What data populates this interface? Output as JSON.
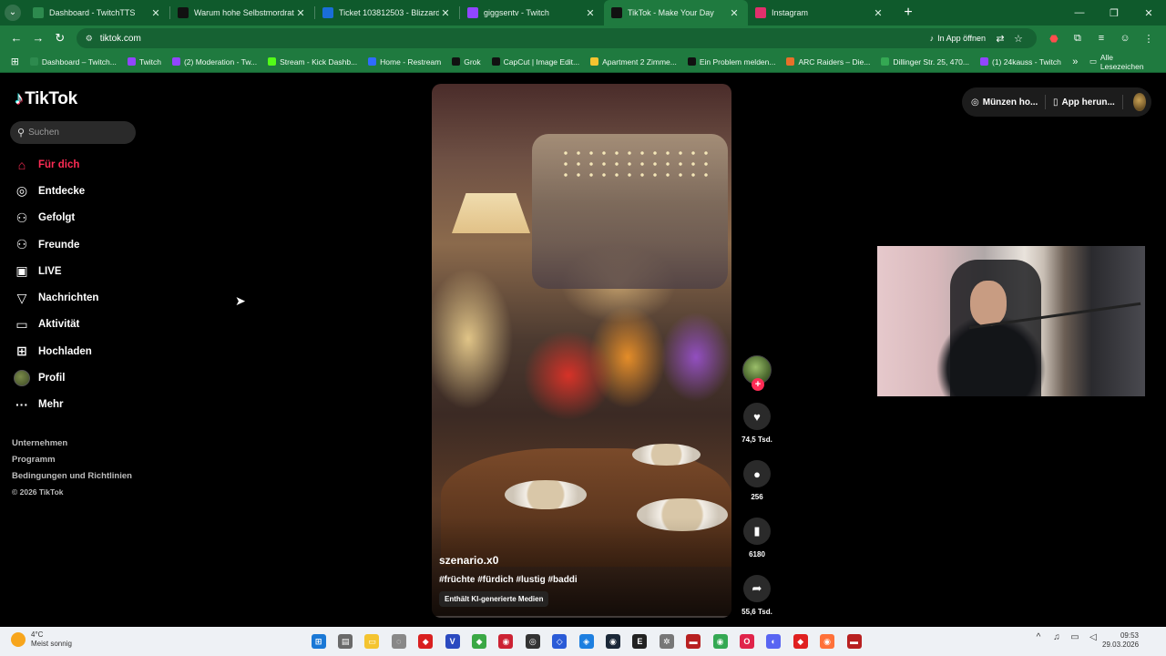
{
  "browser": {
    "tabs": [
      {
        "title": "Dashboard - TwitchTTS",
        "color": "#2d8a4e",
        "active": false
      },
      {
        "title": "Warum hohe Selbstmordrat",
        "color": "#111111",
        "active": false
      },
      {
        "title": "Ticket 103812503 - Blizzard-Ku",
        "color": "#1a6ed8",
        "active": false
      },
      {
        "title": "giggsentv - Twitch",
        "color": "#9146ff",
        "active": false
      },
      {
        "title": "TikTok - Make Your Day",
        "color": "#111111",
        "active": true
      },
      {
        "title": "Instagram",
        "color": "#e1306c",
        "active": false
      }
    ],
    "new_tab": "+",
    "url": "tiktok.com",
    "open_in_app": "In App öffnen",
    "bookmarks": [
      {
        "label": "Dashboard – Twitch...",
        "color": "#2d8a4e"
      },
      {
        "label": "Twitch",
        "color": "#9146ff"
      },
      {
        "label": "(2) Moderation - Tw...",
        "color": "#9146ff"
      },
      {
        "label": "Stream - Kick Dashb...",
        "color": "#53fc18"
      },
      {
        "label": "Home - Restream",
        "color": "#2f6bff"
      },
      {
        "label": "Grok",
        "color": "#111111"
      },
      {
        "label": "CapCut | Image Edit...",
        "color": "#111111"
      },
      {
        "label": "Apartment 2 Zimme...",
        "color": "#f4c430"
      },
      {
        "label": "Ein Problem melden...",
        "color": "#111111"
      },
      {
        "label": "ARC Raiders – Die...",
        "color": "#e8702a"
      },
      {
        "label": "Dillinger Str. 25, 470...",
        "color": "#34a853"
      },
      {
        "label": "(1) 24kauss - Twitch",
        "color": "#9146ff"
      }
    ],
    "all_bookmarks": "Alle Lesezeichen"
  },
  "tiktok": {
    "logo": "TikTok",
    "search_placeholder": "Suchen",
    "nav": [
      {
        "label": "Für dich",
        "icon": "home-icon",
        "glyph": "⌂",
        "active": true
      },
      {
        "label": "Entdecke",
        "icon": "compass-icon",
        "glyph": "◎",
        "active": false
      },
      {
        "label": "Gefolgt",
        "icon": "person-add-icon",
        "glyph": "⚇",
        "active": false
      },
      {
        "label": "Freunde",
        "icon": "friends-icon",
        "glyph": "⚇",
        "active": false
      },
      {
        "label": "LIVE",
        "icon": "live-tv-icon",
        "glyph": "▣",
        "active": false
      },
      {
        "label": "Nachrichten",
        "icon": "send-icon",
        "glyph": "▽",
        "active": false
      },
      {
        "label": "Aktivität",
        "icon": "activity-icon",
        "glyph": "▭",
        "active": false
      },
      {
        "label": "Hochladen",
        "icon": "upload-icon",
        "glyph": "⊞",
        "active": false
      },
      {
        "label": "Profil",
        "icon": "profile-avatar-icon",
        "glyph": "",
        "active": false
      },
      {
        "label": "Mehr",
        "icon": "more-icon",
        "glyph": "···",
        "active": false
      }
    ],
    "footer": [
      "Unternehmen",
      "Programm",
      "Bedingungen und Richtlinien"
    ],
    "copyright": "© 2026 TikTok",
    "header": {
      "coins": "Münzen ho...",
      "app": "App herun..."
    },
    "video": {
      "author": "szenario.x0",
      "tags": "#früchte #fürdich #lustig #baddi",
      "ai_label": "Enthält KI-generierte Medien"
    },
    "actions": {
      "likes": "74,5 Tsd.",
      "comments": "256",
      "saves": "6180",
      "shares": "55,6 Tsd."
    }
  },
  "taskbar": {
    "temperature": "4°C",
    "weather": "Meist sonnig",
    "time": "09:53",
    "date": "29.03.2026",
    "apps": [
      {
        "name": "start-button",
        "color": "#1a78d6",
        "glyph": "⊞"
      },
      {
        "name": "calculator-app",
        "color": "#6a6a6a",
        "glyph": "▤"
      },
      {
        "name": "file-explorer-app",
        "color": "#f4c430",
        "glyph": "▭"
      },
      {
        "name": "mouse-app",
        "color": "#888888",
        "glyph": "◌"
      },
      {
        "name": "red-app",
        "color": "#d92020",
        "glyph": "◆"
      },
      {
        "name": "v-app",
        "color": "#2b4ac0",
        "glyph": "V"
      },
      {
        "name": "green-app",
        "color": "#3aa845",
        "glyph": "◆"
      },
      {
        "name": "red-round-app",
        "color": "#cc2233",
        "glyph": "◉"
      },
      {
        "name": "obs-app",
        "color": "#333333",
        "glyph": "◎"
      },
      {
        "name": "blue-app",
        "color": "#2a5bd7",
        "glyph": "◇"
      },
      {
        "name": "blue-app-2",
        "color": "#1d7fe0",
        "glyph": "◈"
      },
      {
        "name": "steam-app",
        "color": "#1b2838",
        "glyph": "◉"
      },
      {
        "name": "epic-app",
        "color": "#222222",
        "glyph": "E"
      },
      {
        "name": "settings-app",
        "color": "#777777",
        "glyph": "✲"
      },
      {
        "name": "stream-app",
        "color": "#b82020",
        "glyph": "▬"
      },
      {
        "name": "chrome-app",
        "color": "#34a853",
        "glyph": "◉"
      },
      {
        "name": "opera-app",
        "color": "#e0244a",
        "glyph": "O"
      },
      {
        "name": "discord-app",
        "color": "#5865f2",
        "glyph": "◐"
      },
      {
        "name": "red-bird-app",
        "color": "#e02020",
        "glyph": "◆"
      },
      {
        "name": "firefox-app",
        "color": "#ff7139",
        "glyph": "◉"
      },
      {
        "name": "stream-app-2",
        "color": "#b82020",
        "glyph": "▬"
      }
    ]
  }
}
